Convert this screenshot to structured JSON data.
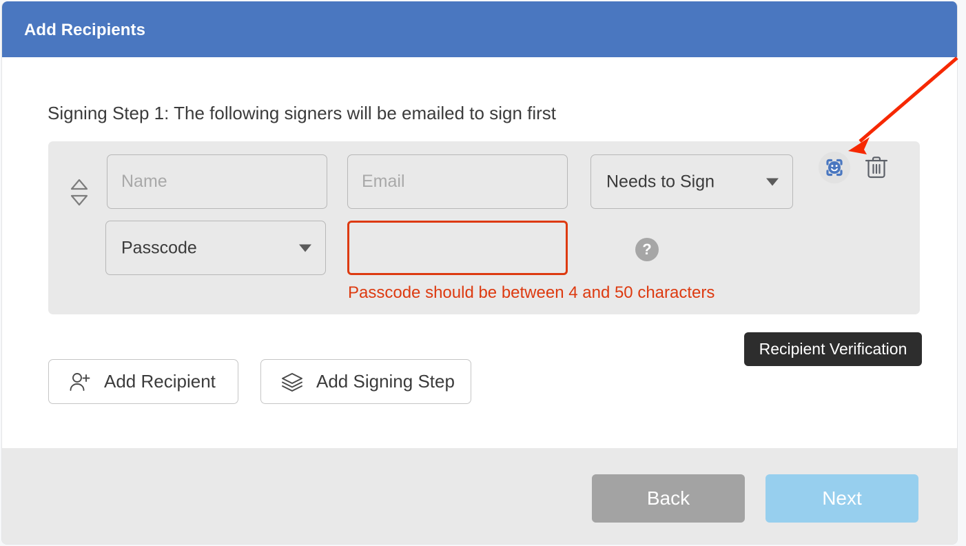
{
  "modal": {
    "title": "Add Recipients",
    "header_color": "#4a77c0"
  },
  "step": {
    "heading": "Signing Step 1: The following signers will be emailed to sign first"
  },
  "recipient_row": {
    "sort_handle_icon": "sort-updown-icon",
    "name_field": {
      "value": "",
      "placeholder": "Name"
    },
    "email_field": {
      "value": "",
      "placeholder": "Email"
    },
    "role_select": {
      "value": "Needs to Sign",
      "caret_icon": "chevron-down-icon"
    },
    "passcode_type_select": {
      "value": "Passcode",
      "caret_icon": "chevron-down-icon"
    },
    "passcode_value_field": {
      "value": "",
      "placeholder": ""
    },
    "help_icon": "question-mark-icon",
    "error_message": "Passcode should be between 4 and 50 characters",
    "error_color": "#dd3a10",
    "verification_icon": "face-scan-smiley-icon",
    "delete_icon": "trash-icon"
  },
  "tooltip": {
    "text": "Recipient Verification",
    "background_color": "#2d2d2d"
  },
  "actions": {
    "add_recipient": {
      "label": "Add Recipient",
      "icon": "user-plus-icon"
    },
    "add_signing_step": {
      "label": "Add Signing Step",
      "icon": "layers-stack-icon"
    }
  },
  "footer": {
    "back_button": {
      "label": "Back",
      "color": "#a3a3a3"
    },
    "next_button": {
      "label": "Next",
      "color": "#97cfee"
    }
  },
  "annotation": {
    "arrow_color": "#f62800"
  }
}
